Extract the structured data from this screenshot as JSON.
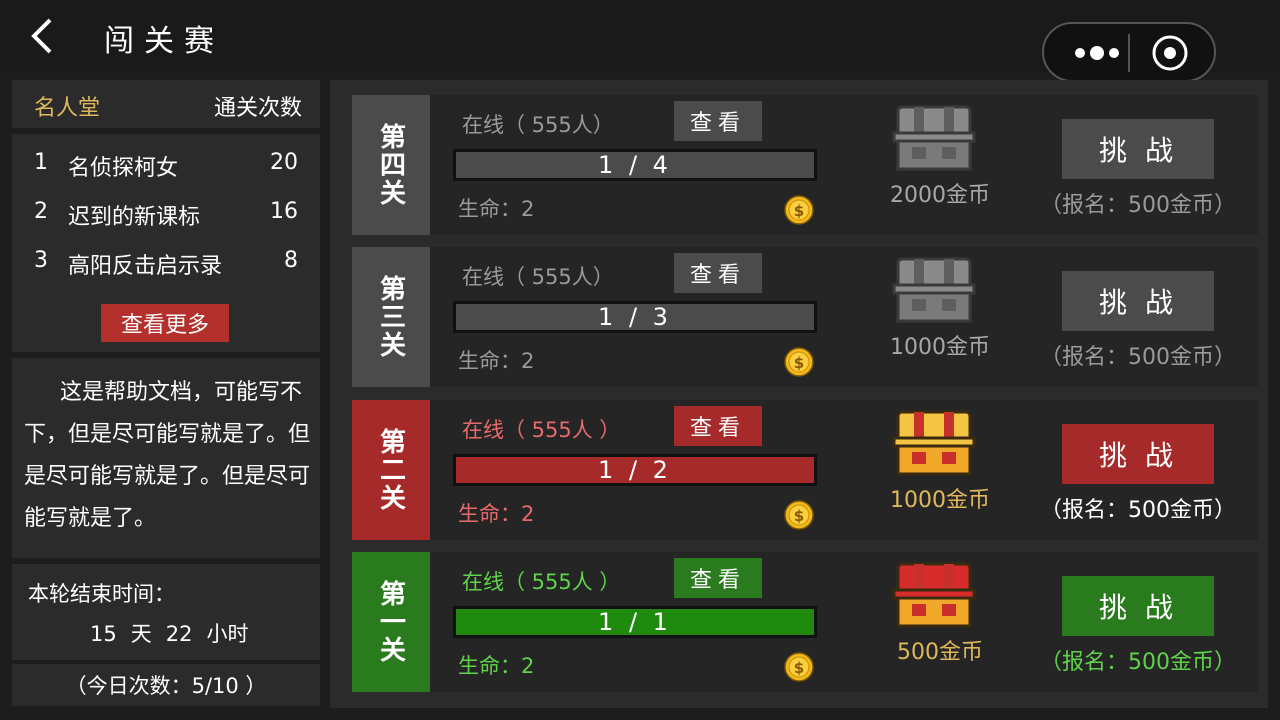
{
  "header": {
    "title": "闯关赛",
    "back_icon": "back-chevron-icon",
    "more_icon": "more-dots-icon",
    "close_icon": "target-circle-icon"
  },
  "fame": {
    "title": "名人堂",
    "count_header": "通关次数",
    "rows": [
      {
        "rank": "1",
        "name": "名侦探柯女",
        "count": "20"
      },
      {
        "rank": "2",
        "name": "迟到的新课标",
        "count": "16"
      },
      {
        "rank": "3",
        "name": "高阳反击启示录",
        "count": "8"
      }
    ],
    "more_label": "查看更多"
  },
  "help": {
    "text": "这是帮助文档，可能写不下，但是尽可能写就是了。但是尽可能写就是了。但是尽可能写就是了。"
  },
  "round": {
    "end_label": "本轮结束时间：",
    "days": "15",
    "day_unit": "天",
    "hours": "22",
    "hour_unit": "小时"
  },
  "today": {
    "text": "（今日次数：5/10 ）"
  },
  "colors": {
    "locked": "#4b4b4b",
    "red": "#a62a2a",
    "green": "#2a7a1e",
    "gold": "#e0b85c"
  },
  "levels": [
    {
      "tag": "第四关",
      "online": "在线（ 555人）",
      "view": "查看",
      "progress": "1 / 4",
      "progress_fill": 1.0,
      "life": "生命：2",
      "reward": "2000金币",
      "challenge": "挑战",
      "fee": "（报名：500金币）",
      "theme": "gray",
      "chest": "gray"
    },
    {
      "tag": "第三关",
      "online": "在线（ 555人）",
      "view": "查看",
      "progress": "1 / 3",
      "progress_fill": 1.0,
      "life": "生命：2",
      "reward": "1000金币",
      "challenge": "挑战",
      "fee": "（报名：500金币）",
      "theme": "gray",
      "chest": "gray"
    },
    {
      "tag": "第二关",
      "online": "在线（ 555人 ）",
      "view": "查看",
      "progress": "1 / 2",
      "progress_fill": 1.0,
      "life": "生命：2",
      "reward": "1000金币",
      "challenge": "挑战",
      "fee": "（报名：500金币）",
      "theme": "red",
      "chest": "gold"
    },
    {
      "tag": "第一关",
      "online": "在线（ 555人 ）",
      "view": "查看",
      "progress": "1 / 1",
      "progress_fill": 1.0,
      "life": "生命：2",
      "reward": "500金币",
      "challenge": "挑战",
      "fee": "（报名：500金币）",
      "theme": "green",
      "chest": "red"
    }
  ]
}
